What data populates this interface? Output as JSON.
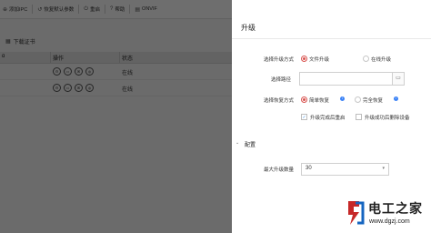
{
  "toolbar": {
    "items": [
      {
        "icon": "add-icon",
        "label": "添加IPC"
      },
      {
        "icon": "restore-icon",
        "label": "恢复默认参数"
      },
      {
        "icon": "reboot-icon",
        "label": "重启"
      },
      {
        "icon": "help-icon",
        "label": "帮助"
      },
      {
        "icon": "onvif-icon",
        "label": "ONVIF"
      }
    ]
  },
  "subbar": {
    "label": "下载证书"
  },
  "table": {
    "headers": [
      "ɑ",
      "操作",
      "状态"
    ],
    "rows": [
      {
        "status": "在线"
      },
      {
        "status": "在线"
      }
    ]
  },
  "panel": {
    "title": "升级",
    "upgrade_method_label": "选择升级方式",
    "method_options": [
      "文件升级",
      "在线升级"
    ],
    "path_label": "选择路径",
    "path_value": "",
    "restore_label": "选择恢复方式",
    "restore_options": [
      "简单恢复",
      "完全恢复"
    ],
    "checkboxes": [
      "升级完成后重启",
      "升级成功后删除设备"
    ],
    "config_section": "配置",
    "max_label": "最大升级数量",
    "max_value": "30"
  },
  "watermark": {
    "title": "电工之家",
    "url": "www.dgzj.com"
  },
  "colors": {
    "accent": "#1f7fe5",
    "info": "#3b82f6",
    "watermark_red": "#c62828"
  }
}
